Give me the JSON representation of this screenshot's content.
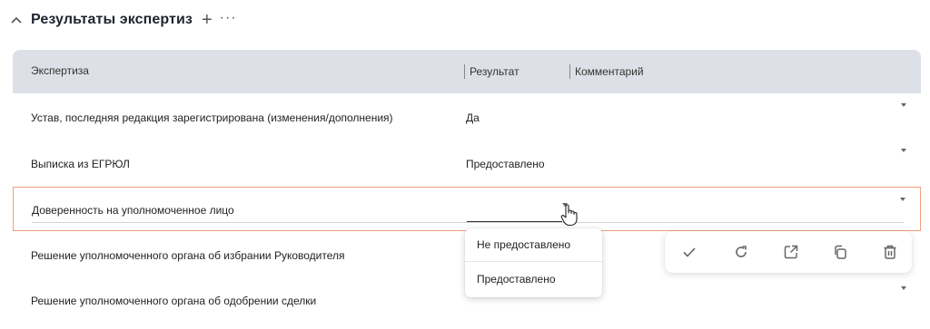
{
  "section": {
    "title": "Результаты экспертиз",
    "add_label": "+",
    "more_label": "···"
  },
  "table": {
    "columns": [
      "Экспертиза",
      "Результат",
      "Комментарий"
    ],
    "rows": [
      {
        "name": "Устав, последняя редакция зарегистрирована (изменения/дополнения)",
        "result": "Да"
      },
      {
        "name": "Выписка из ЕГРЮЛ",
        "result": "Предоставлено"
      },
      {
        "name": "Доверенность на уполномоченное лицо",
        "result": ""
      },
      {
        "name": "Решение уполномоченного органа об избрании Руководителя",
        "result": ""
      },
      {
        "name": "Решение уполномоченного органа об одобрении сделки",
        "result": ""
      }
    ]
  },
  "dropdown": {
    "options": [
      "Не предоставлено",
      "Предоставлено"
    ]
  },
  "toolbar": {
    "icons": [
      "check-icon",
      "refresh-icon",
      "open-external-icon",
      "copy-icon",
      "trash-icon"
    ]
  },
  "colors": {
    "header_bg": "#dde0e6",
    "active_border": "#f0a07a",
    "icon": "#666666"
  }
}
